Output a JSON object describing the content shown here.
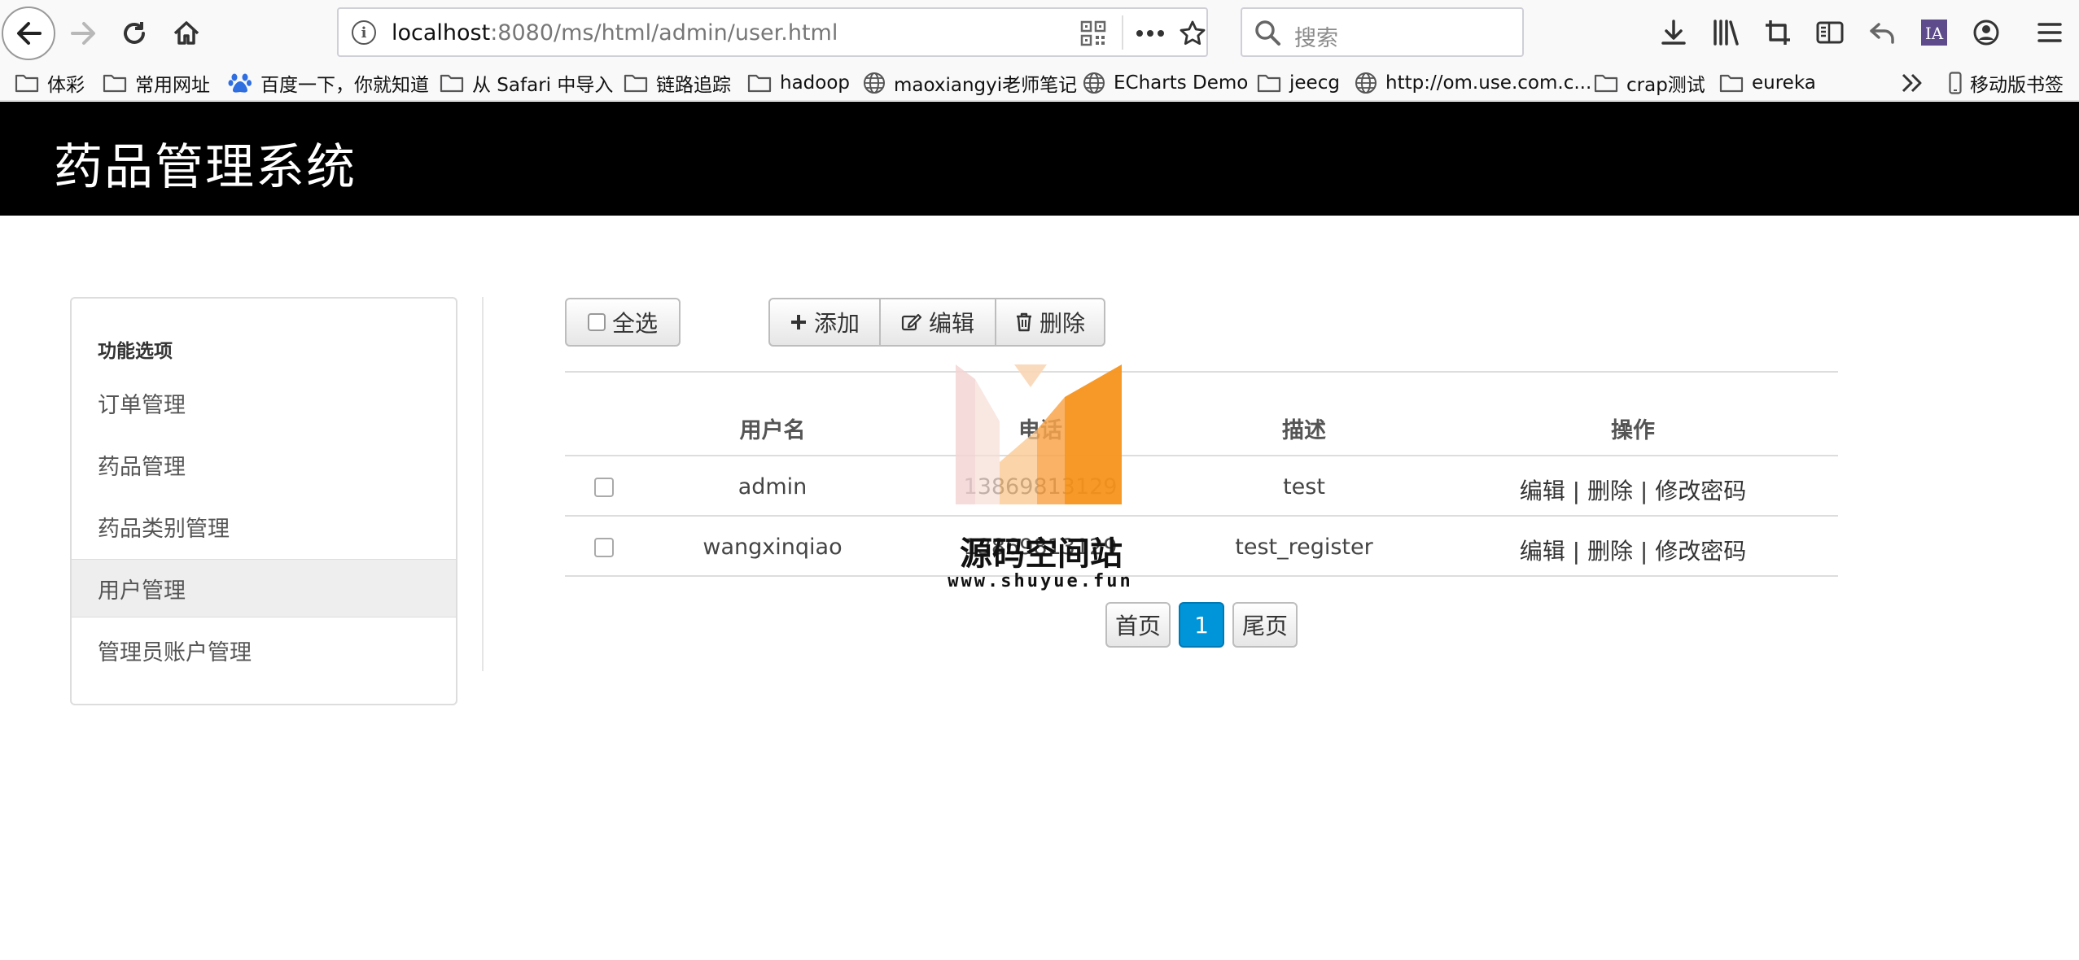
{
  "browser": {
    "url_host": "localhost",
    "url_rest": ":8080/ms/html/admin/user.html",
    "search_placeholder": "搜索",
    "bookmarks": [
      {
        "label": "体彩",
        "icon": "folder-icon"
      },
      {
        "label": "常用网址",
        "icon": "folder-icon"
      },
      {
        "label": "百度一下，你就知道",
        "icon": "baidu-paw-icon"
      },
      {
        "label": "从 Safari 中导入",
        "icon": "folder-icon"
      },
      {
        "label": "链路追踪",
        "icon": "folder-icon"
      },
      {
        "label": "hadoop",
        "icon": "folder-icon"
      },
      {
        "label": "maoxiangyi老师笔记",
        "icon": "globe-icon"
      },
      {
        "label": "ECharts Demo",
        "icon": "globe-icon"
      },
      {
        "label": "jeecg",
        "icon": "folder-icon"
      },
      {
        "label": "http://om.use.com.c...",
        "icon": "globe-icon"
      },
      {
        "label": "crap测试",
        "icon": "folder-icon"
      },
      {
        "label": "eureka",
        "icon": "folder-icon"
      }
    ],
    "mobile_bookmarks": "移动版书签"
  },
  "app": {
    "title": "药品管理系统"
  },
  "sidebar": {
    "heading": "功能选项",
    "items": [
      {
        "label": "订单管理",
        "active": false
      },
      {
        "label": "药品管理",
        "active": false
      },
      {
        "label": "药品类别管理",
        "active": false
      },
      {
        "label": "用户管理",
        "active": true
      },
      {
        "label": "管理员账户管理",
        "active": false
      }
    ]
  },
  "toolbar": {
    "select_all": "全选",
    "add": "添加",
    "edit": "编辑",
    "delete": "删除"
  },
  "table": {
    "headers": [
      "用户名",
      "电话",
      "描述",
      "操作"
    ],
    "rows": [
      {
        "username": "admin",
        "phone": "13869813129",
        "description": "test"
      },
      {
        "username": "wangxinqiao",
        "phone": "13869813129",
        "description": "test_register"
      }
    ],
    "row_actions": {
      "edit": "编辑",
      "delete": "删除",
      "change_password": "修改密码",
      "separator": "|"
    }
  },
  "pagination": {
    "first": "首页",
    "current": "1",
    "last": "尾页"
  },
  "watermark": {
    "name": "源码空间站",
    "url": "www.shuyue.fun"
  },
  "colors": {
    "header_bg": "#000000",
    "page_active": "#0095d9",
    "watermark_orange": "#f7941d"
  }
}
